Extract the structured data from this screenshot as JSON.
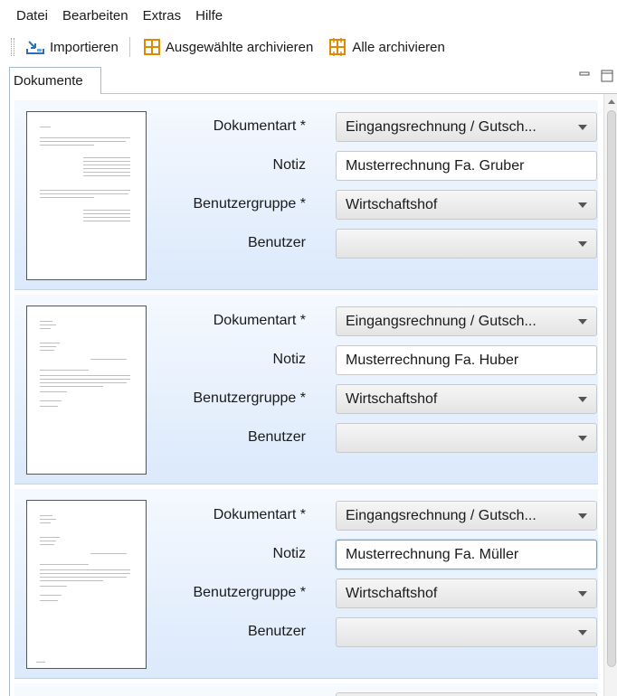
{
  "menu": {
    "items": [
      "Datei",
      "Bearbeiten",
      "Extras",
      "Hilfe"
    ]
  },
  "toolbar": {
    "import_label": "Importieren",
    "archive_selected_label": "Ausgewählte archivieren",
    "archive_all_label": "Alle archivieren",
    "icons": {
      "import": "import-icon",
      "archive": "archive-icon"
    }
  },
  "tab": {
    "label": "Dokumente",
    "minimize_icon": "minimize-icon",
    "maximize_icon": "maximize-icon"
  },
  "labels": {
    "doctype": "Dokumentart *",
    "note": "Notiz",
    "usergroup": "Benutzergruppe *",
    "user": "Benutzer"
  },
  "documents": [
    {
      "doctype": "Eingangsrechnung / Gutsch...",
      "note": "Musterrechnung Fa. Gruber",
      "usergroup": "Wirtschaftshof",
      "user": ""
    },
    {
      "doctype": "Eingangsrechnung / Gutsch...",
      "note": "Musterrechnung Fa. Huber",
      "usergroup": "Wirtschaftshof",
      "user": ""
    },
    {
      "doctype": "Eingangsrechnung / Gutsch...",
      "note": "Musterrechnung Fa. Müller",
      "usergroup": "Wirtschaftshof",
      "user": ""
    }
  ],
  "colors": {
    "accent": "#5fa8d8",
    "card_top": "#f5f9ff",
    "card_bottom": "#dbe9fb",
    "archive_icon": "#e08a00"
  }
}
